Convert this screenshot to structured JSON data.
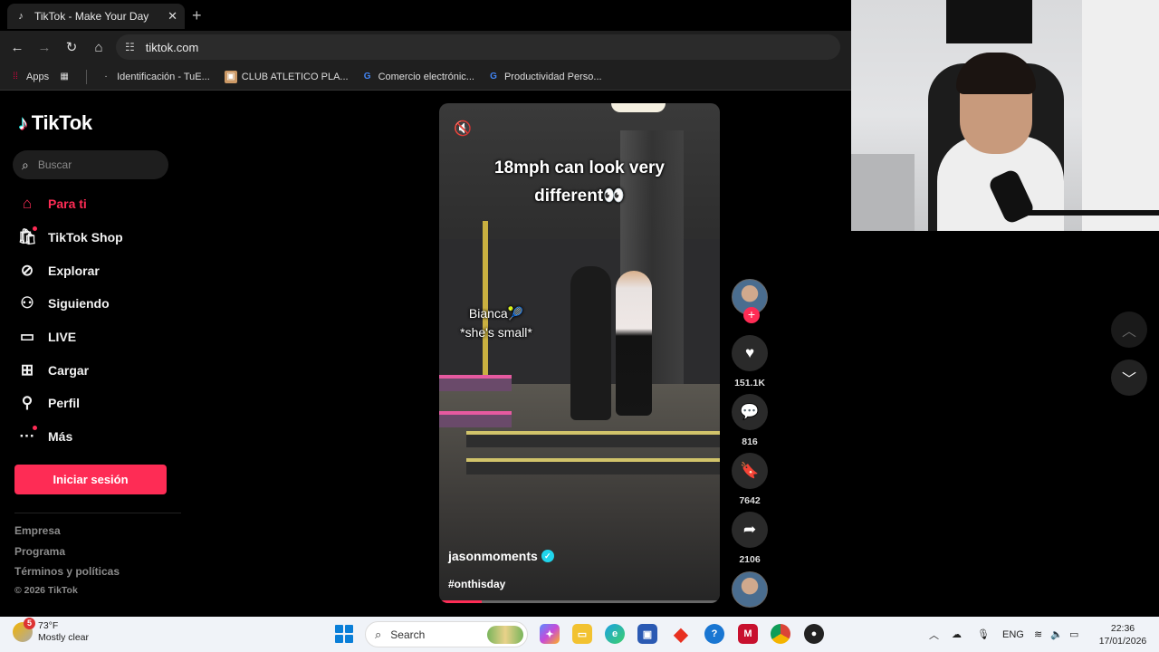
{
  "browser": {
    "tab_title": "TikTok - Make Your Day",
    "tab_close": "✕",
    "new_tab": "+",
    "url": "tiktok.com",
    "bookmarks": [
      {
        "label": "Apps",
        "icon": "apps-grid-icon"
      },
      {
        "label": "Identificación - TuE...",
        "icon": "generic-page-icon"
      },
      {
        "label": "CLUB ATLETICO PLA...",
        "icon": "club-crest-icon"
      },
      {
        "label": "Comercio electrónic...",
        "icon": "google-icon"
      },
      {
        "label": "Productividad Perso...",
        "icon": "google-icon"
      }
    ]
  },
  "sidebar": {
    "logo_text": "TikTok",
    "search_placeholder": "Buscar",
    "nav": [
      {
        "label": "Para ti",
        "icon": "home-icon",
        "active": true
      },
      {
        "label": "TikTok Shop",
        "icon": "shop-bag-icon"
      },
      {
        "label": "Explorar",
        "icon": "compass-icon"
      },
      {
        "label": "Siguiendo",
        "icon": "following-icon"
      },
      {
        "label": "LIVE",
        "icon": "live-icon"
      },
      {
        "label": "Cargar",
        "icon": "upload-icon"
      },
      {
        "label": "Perfil",
        "icon": "profile-icon"
      },
      {
        "label": "Más",
        "icon": "more-icon"
      }
    ],
    "login_button": "Iniciar sesión",
    "footer_links": [
      "Empresa",
      "Programa",
      "Términos y políticas"
    ],
    "copyright": "© 2026 TikTok"
  },
  "video": {
    "caption_line1": "18mph can look very",
    "caption_line2": "different👀",
    "side_caption_line1": "Bianca🎾",
    "side_caption_line2": "*she's small*",
    "author": "jasonmoments",
    "hashtag": "#onthisday",
    "progress": 0.15,
    "muted": true
  },
  "actions": {
    "likes": "151.1K",
    "comments": "816",
    "saves": "7642",
    "shares": "2106"
  },
  "colors": {
    "accent": "#fe2c55",
    "verified": "#20d5ec"
  },
  "taskbar": {
    "weather_temp": "73°F",
    "weather_desc": "Mostly clear",
    "weather_badge": "5",
    "search_label": "Search",
    "language": "ENG",
    "time": "22:36",
    "date": "17/01/2026"
  }
}
